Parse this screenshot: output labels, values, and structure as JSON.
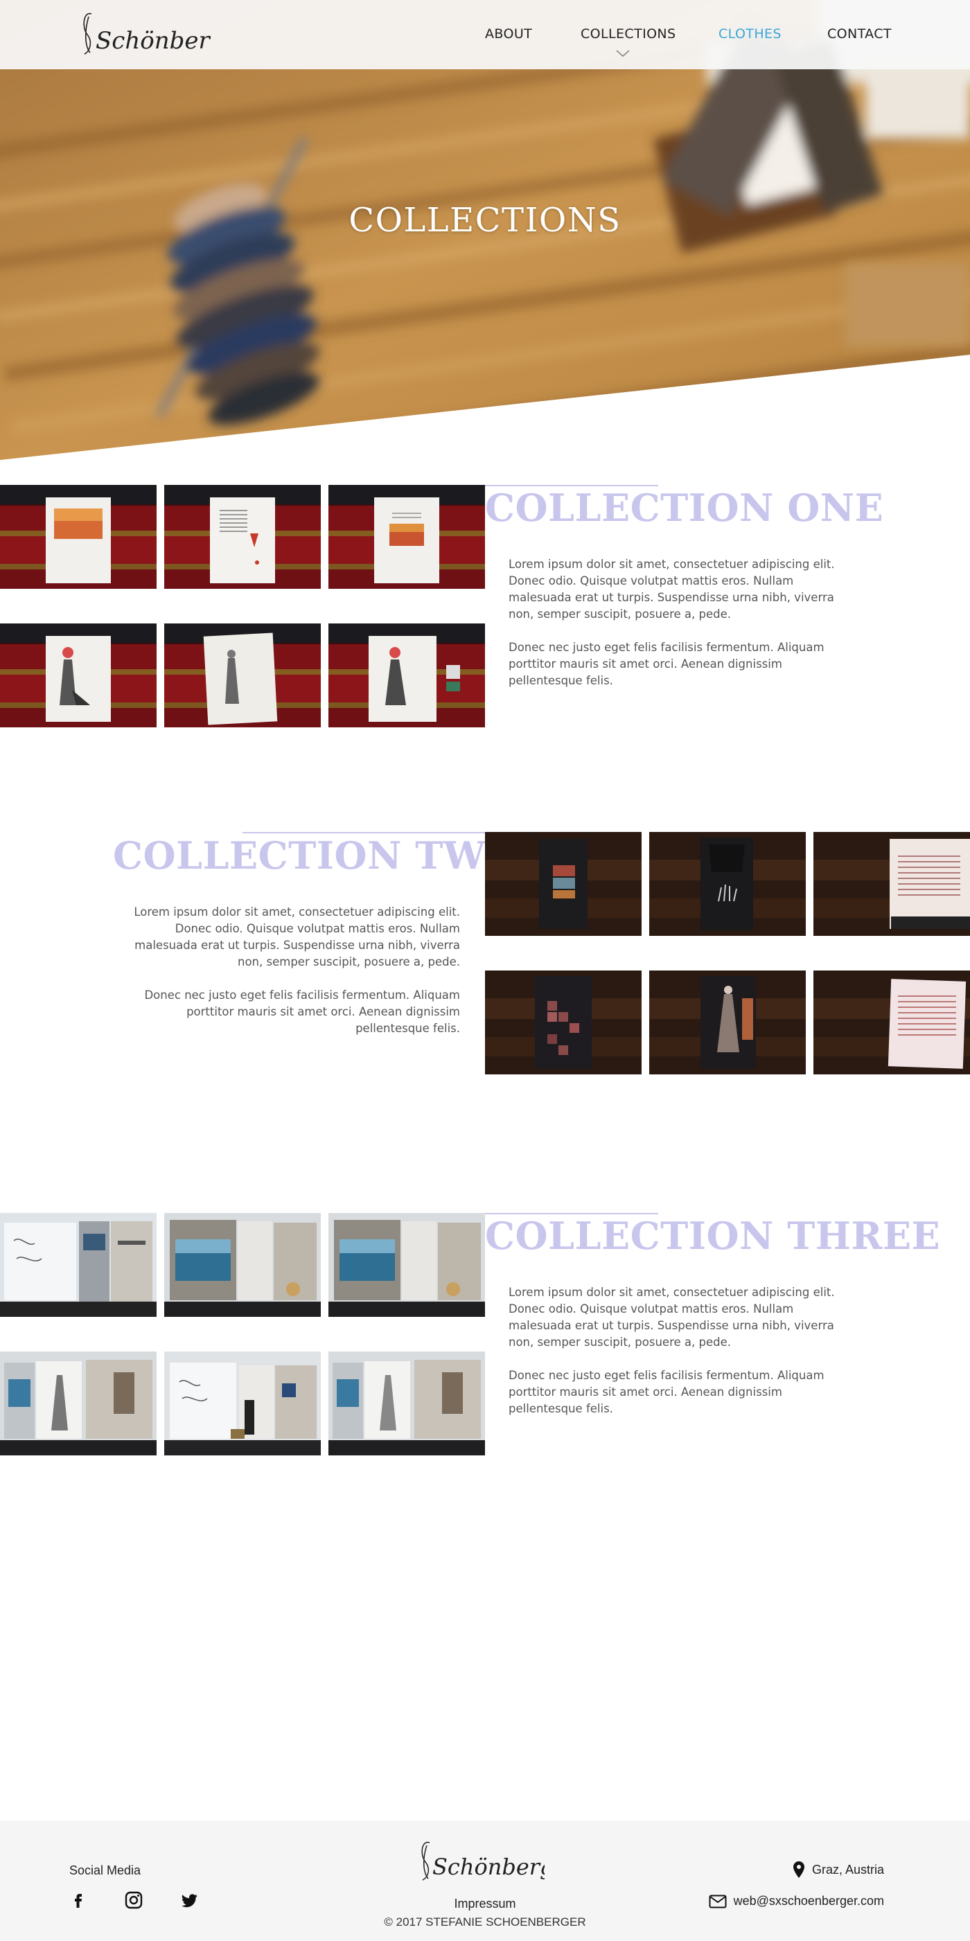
{
  "brand": {
    "logo_text": "Schönberger"
  },
  "nav": {
    "items": [
      {
        "label": "ABOUT"
      },
      {
        "label": "COLLECTIONS"
      },
      {
        "label": "CLOTHES"
      },
      {
        "label": "CONTACT"
      }
    ],
    "active_color": "#3aa7d6"
  },
  "hero": {
    "title": "COLLECTIONS"
  },
  "collections": [
    {
      "title": "COLLECTION ONE",
      "paragraphs": [
        "Lorem ipsum dolor sit amet, consectetuer adipiscing elit. Donec odio. Quisque volutpat mattis eros. Nullam malesuada erat ut turpis. Suspendisse urna nibh, viverra non, semper suscipit, posuere a, pede.",
        "Donec nec justo eget felis facilisis fermentum. Aliquam porttitor mauris sit amet orci. Aenean dignissim pellentesque felis."
      ]
    },
    {
      "title": "COLLECTION TWO",
      "paragraphs": [
        "Lorem ipsum dolor sit amet, consectetuer adipiscing elit. Donec odio. Quisque volutpat mattis eros. Nullam malesuada erat ut turpis. Suspendisse urna nibh, viverra non, semper suscipit, posuere a, pede.",
        "Donec nec justo eget felis facilisis fermentum. Aliquam porttitor mauris sit amet orci. Aenean dignissim pellentesque felis."
      ]
    },
    {
      "title": "COLLECTION THREE",
      "paragraphs": [
        "Lorem ipsum dolor sit amet, consectetuer adipiscing elit. Donec odio. Quisque volutpat mattis eros. Nullam malesuada erat ut turpis. Suspendisse urna nibh, viverra non, semper suscipit, posuere a, pede.",
        "Donec nec justo eget felis facilisis fermentum. Aliquam porttitor mauris sit amet orci. Aenean dignissim pellentesque felis."
      ]
    }
  ],
  "theme": {
    "accent_title": "#c8c6ec"
  },
  "footer": {
    "social_title": "Social Media",
    "social_icons": [
      "facebook-icon",
      "instagram-icon",
      "twitter-icon"
    ],
    "impressum": "Impressum",
    "copyright": "© 2017 STEFANIE SCHOENBERGER",
    "location": "Graz, Austria",
    "email": "web@sxschoenberger.com"
  }
}
